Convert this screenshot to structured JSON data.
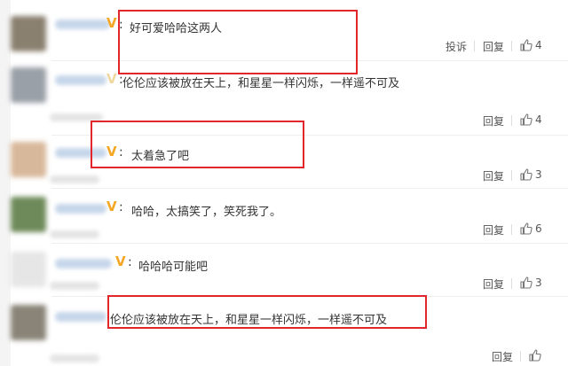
{
  "comments": [
    {
      "text": "好可爱哈哈这两人",
      "show_colon": true,
      "actions": {
        "report": "投诉",
        "reply": "回复"
      },
      "likes": "4",
      "avatar_color": "#8a8070"
    },
    {
      "text": "伦伦应该被放在天上，和星星一样闪烁，一样遥不可及",
      "show_colon": true,
      "actions": {
        "reply": "回复"
      },
      "likes": "4",
      "avatar_color": "#9aa0a8"
    },
    {
      "text": "太着急了吧",
      "show_colon": true,
      "actions": {
        "reply": "回复"
      },
      "likes": "3",
      "avatar_color": "#d8b89a"
    },
    {
      "text": "哈哈，太搞笑了，笑死我了。",
      "show_colon": true,
      "actions": {
        "reply": "回复"
      },
      "likes": "6",
      "avatar_color": "#6e8a5a"
    },
    {
      "text": "哈哈哈可能吧",
      "show_colon": true,
      "actions": {
        "reply": "回复"
      },
      "likes": "3",
      "avatar_color": "#e6e6e6"
    },
    {
      "text": "伦伦应该被放在天上，和星星一样闪烁，一样遥不可及",
      "show_colon": false,
      "actions": {
        "reply": "回复"
      },
      "likes": "",
      "avatar_color": "#8a8478"
    }
  ],
  "highlight_color": "#e2262b",
  "vip_color": "#f5a623"
}
